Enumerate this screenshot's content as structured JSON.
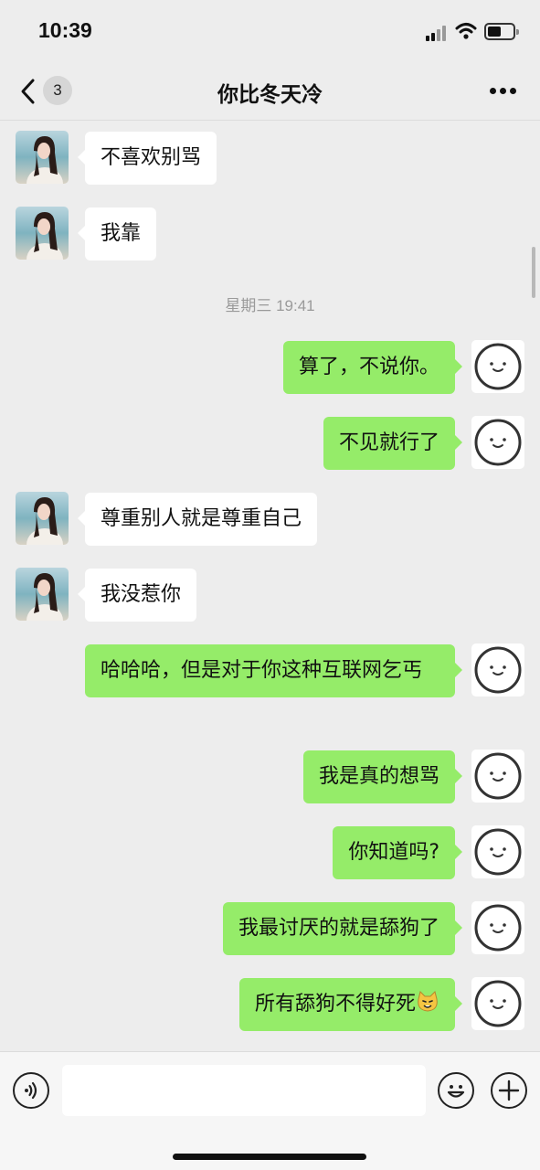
{
  "status_bar": {
    "time": "10:39"
  },
  "nav": {
    "title": "你比冬天冷",
    "unread_count": "3",
    "back_icon": "chevron-left-icon",
    "more_icon": "more-dots-icon"
  },
  "messages": [
    {
      "from": "other",
      "text": "不喜欢别骂"
    },
    {
      "from": "other",
      "text": "我靠"
    },
    {
      "from": "self",
      "text": "算了，不说你。"
    },
    {
      "from": "self",
      "text": "不见就行了"
    },
    {
      "from": "other",
      "text": "尊重别人就是尊重自己"
    },
    {
      "from": "other",
      "text": "我没惹你"
    },
    {
      "from": "self",
      "text": "哈哈哈，但是对于你这种互联网乞丐"
    },
    {
      "from": "self",
      "text": "我是真的想骂"
    },
    {
      "from": "self",
      "text": "你知道吗?"
    },
    {
      "from": "self",
      "text": "我最讨厌的就是舔狗了"
    },
    {
      "from": "self",
      "text": "所有舔狗不得好死",
      "emoji": "cat-face-emoji"
    }
  ],
  "timestamp": "星期三 19:41",
  "input_bar": {
    "voice_icon": "voice-icon",
    "emoji_icon": "smiley-icon",
    "plus_icon": "plus-icon"
  },
  "colors": {
    "background": "#ededed",
    "outgoing_bubble": "#95ec69",
    "incoming_bubble": "#ffffff"
  }
}
